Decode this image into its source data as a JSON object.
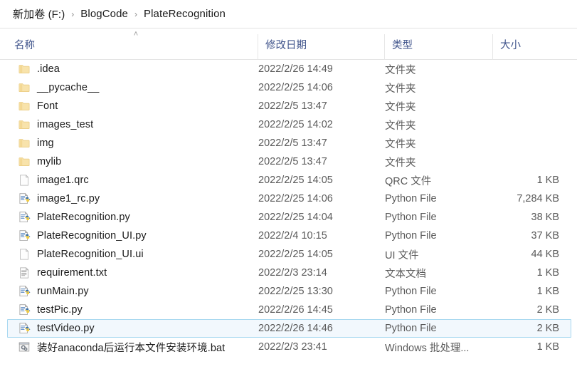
{
  "breadcrumb": {
    "separator": "›",
    "items": [
      {
        "label": "新加卷 (F:)"
      },
      {
        "label": "BlogCode"
      },
      {
        "label": "PlateRecognition"
      }
    ]
  },
  "columns": {
    "name": "名称",
    "date_modified": "修改日期",
    "type": "类型",
    "size": "大小",
    "sort_indicator": "˄",
    "sort_column": "名称",
    "sort_direction": "ascending"
  },
  "colors": {
    "header_text": "#41558c",
    "row_text": "#1b1b1b",
    "meta_text": "#5a5a5a",
    "selection_border": "#a8d8f0",
    "selection_fill": "#f2f8fd",
    "folder_icon": "#f6dd9a"
  },
  "files": [
    {
      "name": ".idea",
      "date": "2022/2/26 14:49",
      "type": "文件夹",
      "size": "",
      "icon": "folder-icon",
      "selected": false
    },
    {
      "name": "__pycache__",
      "date": "2022/2/25 14:06",
      "type": "文件夹",
      "size": "",
      "icon": "folder-icon",
      "selected": false
    },
    {
      "name": "Font",
      "date": "2022/2/5 13:47",
      "type": "文件夹",
      "size": "",
      "icon": "folder-icon",
      "selected": false
    },
    {
      "name": "images_test",
      "date": "2022/2/25 14:02",
      "type": "文件夹",
      "size": "",
      "icon": "folder-icon",
      "selected": false
    },
    {
      "name": "img",
      "date": "2022/2/5 13:47",
      "type": "文件夹",
      "size": "",
      "icon": "folder-icon",
      "selected": false
    },
    {
      "name": "mylib",
      "date": "2022/2/5 13:47",
      "type": "文件夹",
      "size": "",
      "icon": "folder-icon",
      "selected": false
    },
    {
      "name": "image1.qrc",
      "date": "2022/2/25 14:05",
      "type": "QRC 文件",
      "size": "1 KB",
      "icon": "document-icon",
      "selected": false
    },
    {
      "name": "image1_rc.py",
      "date": "2022/2/25 14:06",
      "type": "Python File",
      "size": "7,284 KB",
      "icon": "python-file-icon",
      "selected": false
    },
    {
      "name": "PlateRecognition.py",
      "date": "2022/2/25 14:04",
      "type": "Python File",
      "size": "38 KB",
      "icon": "python-file-icon",
      "selected": false
    },
    {
      "name": "PlateRecognition_UI.py",
      "date": "2022/2/4 10:15",
      "type": "Python File",
      "size": "37 KB",
      "icon": "python-file-icon",
      "selected": false
    },
    {
      "name": "PlateRecognition_UI.ui",
      "date": "2022/2/25 14:05",
      "type": "UI 文件",
      "size": "44 KB",
      "icon": "document-icon",
      "selected": false
    },
    {
      "name": "requirement.txt",
      "date": "2022/2/3 23:14",
      "type": "文本文档",
      "size": "1 KB",
      "icon": "text-file-icon",
      "selected": false
    },
    {
      "name": "runMain.py",
      "date": "2022/2/25 13:30",
      "type": "Python File",
      "size": "1 KB",
      "icon": "python-file-icon",
      "selected": false
    },
    {
      "name": "testPic.py",
      "date": "2022/2/26 14:45",
      "type": "Python File",
      "size": "2 KB",
      "icon": "python-file-icon",
      "selected": false
    },
    {
      "name": "testVideo.py",
      "date": "2022/2/26 14:46",
      "type": "Python File",
      "size": "2 KB",
      "icon": "python-file-icon",
      "selected": true
    },
    {
      "name": "装好anaconda后运行本文件安装环境.bat",
      "date": "2022/2/3 23:41",
      "type": "Windows 批处理...",
      "size": "1 KB",
      "icon": "batch-file-icon",
      "selected": false
    }
  ]
}
